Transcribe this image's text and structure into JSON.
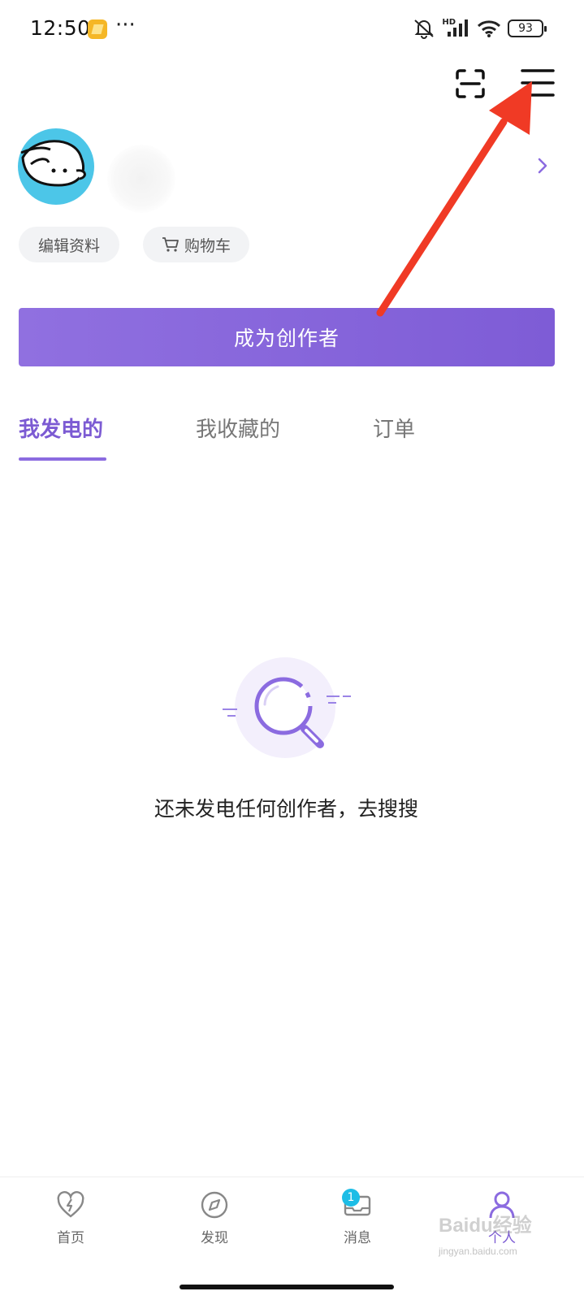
{
  "status_bar": {
    "time": "12:50",
    "more": "···",
    "hd_label": "HD",
    "battery": "93",
    "icons": [
      "mute-bell-icon",
      "signal-icon",
      "wifi-icon",
      "battery-icon"
    ]
  },
  "header": {
    "scan_icon": "scan-icon",
    "menu_icon": "menu-icon"
  },
  "profile": {
    "edit_label": "编辑资料",
    "cart_label": "购物车"
  },
  "creator_button": {
    "label": "成为创作者"
  },
  "tabs": [
    {
      "label": "我发电的",
      "active": true
    },
    {
      "label": "我收藏的",
      "active": false
    },
    {
      "label": "订单",
      "active": false
    }
  ],
  "empty_state": {
    "message": "还未发电任何创作者，去搜搜"
  },
  "bottom_nav": [
    {
      "label": "首页",
      "icon": "lightning-heart-icon"
    },
    {
      "label": "发现",
      "icon": "compass-icon"
    },
    {
      "label": "消息",
      "icon": "mail-icon",
      "badge": "1"
    },
    {
      "label": "个人",
      "icon": "person-icon",
      "active": true
    }
  ],
  "watermark": {
    "text": "Baidu经验",
    "sub": "jingyan.baidu.com"
  },
  "colors": {
    "accent": "#7c5bd3",
    "arrow": "#f03a25",
    "badge": "#1dbde6"
  }
}
